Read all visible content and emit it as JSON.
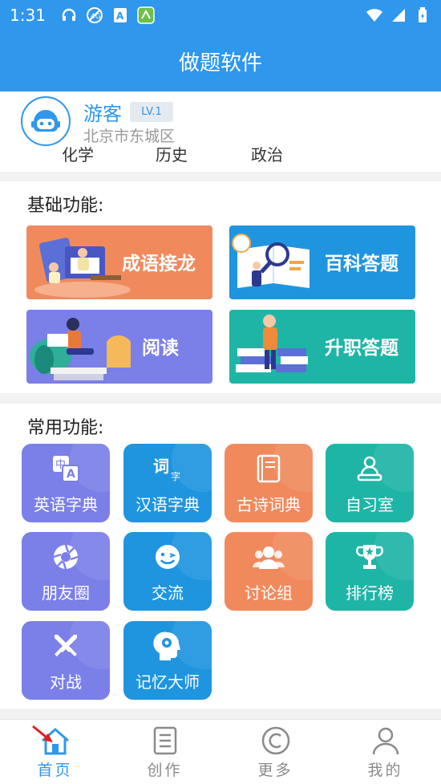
{
  "status_bar": {
    "time": "1:31"
  },
  "app_bar": {
    "title": "做题软件"
  },
  "profile": {
    "name": "游客",
    "level": "LV.1",
    "location": "北京市东城区",
    "subjects": [
      "化学",
      "历史",
      "政治"
    ]
  },
  "basic": {
    "title": "基础功能:",
    "cards": [
      {
        "label": "成语接龙",
        "color": "#f08a5d"
      },
      {
        "label": "百科答题",
        "color": "#1f95e0"
      },
      {
        "label": "阅读",
        "color": "#7b7fe8"
      },
      {
        "label": "升职答题",
        "color": "#1fb5a6"
      }
    ]
  },
  "common": {
    "title": "常用功能:",
    "tiles": [
      {
        "label": "英语字典",
        "icon": "translate-icon"
      },
      {
        "label": "汉语字典",
        "icon": "word-dictionary-icon"
      },
      {
        "label": "古诗词典",
        "icon": "book-icon"
      },
      {
        "label": "自习室",
        "icon": "study-room-icon"
      },
      {
        "label": "朋友圈",
        "icon": "aperture-icon"
      },
      {
        "label": "交流",
        "icon": "smile-chat-icon"
      },
      {
        "label": "讨论组",
        "icon": "group-icon"
      },
      {
        "label": "排行榜",
        "icon": "trophy-icon"
      },
      {
        "label": "对战",
        "icon": "crossed-swords-icon"
      },
      {
        "label": "记忆大师",
        "icon": "brain-gear-icon"
      }
    ]
  },
  "bottom_nav": {
    "items": [
      {
        "label": "首页",
        "icon": "home-icon",
        "active": true
      },
      {
        "label": "创作",
        "icon": "document-icon",
        "active": false
      },
      {
        "label": "更多",
        "icon": "copyright-circle-icon",
        "active": false
      },
      {
        "label": "我的",
        "icon": "user-icon",
        "active": false
      }
    ]
  },
  "colors": {
    "primary": "#2f97ec",
    "tile_purple": "#7b7fe8",
    "tile_blue": "#1f95e0",
    "tile_orange": "#f08a5d",
    "tile_teal": "#1fb5a6"
  }
}
